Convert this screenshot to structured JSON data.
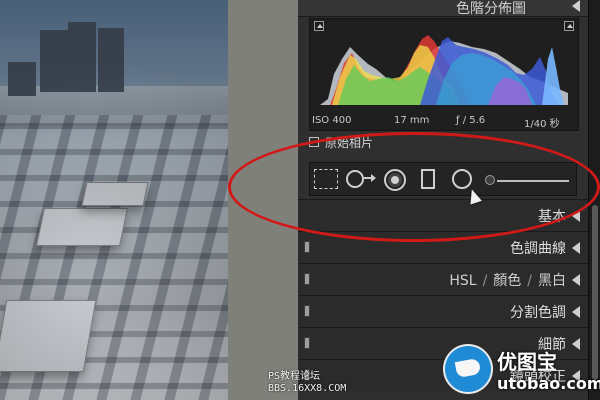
{
  "panel_header": {
    "title": "色階分佈圖"
  },
  "histogram": {
    "iso": "ISO 400",
    "focal": "17 mm",
    "aperture": "ƒ / 5.6",
    "shutter": "1/40 秒"
  },
  "original_photo": {
    "label": "原始相片"
  },
  "tool_strip": {
    "tools": [
      {
        "id": "crop",
        "icon": "crop-overlay-icon"
      },
      {
        "id": "spot",
        "icon": "spot-removal-icon"
      },
      {
        "id": "red_eye",
        "icon": "red-eye-correction-icon"
      },
      {
        "id": "graduated",
        "icon": "graduated-filter-icon"
      },
      {
        "id": "radial",
        "icon": "radial-filter-icon"
      },
      {
        "id": "brush",
        "icon": "adjustment-brush-icon"
      }
    ]
  },
  "sections": [
    {
      "label": "基本"
    },
    {
      "label": "色調曲線"
    },
    {
      "label_parts": [
        "HSL",
        "/",
        "顏色",
        "/",
        "黑白"
      ]
    },
    {
      "label": "分割色調"
    },
    {
      "label": "細節"
    },
    {
      "label": "鏡頭校正"
    }
  ],
  "watermarks": {
    "ps_line1": "PS教程论坛",
    "ps_line2": "BBS.16XX8.COM",
    "brand_cn": "优图宝",
    "brand_en": "utobao.com"
  },
  "colors": {
    "highlight_ellipse": "#d11a17",
    "panel_bg": "#2f2f2f",
    "divider_bg": "#80807b"
  }
}
